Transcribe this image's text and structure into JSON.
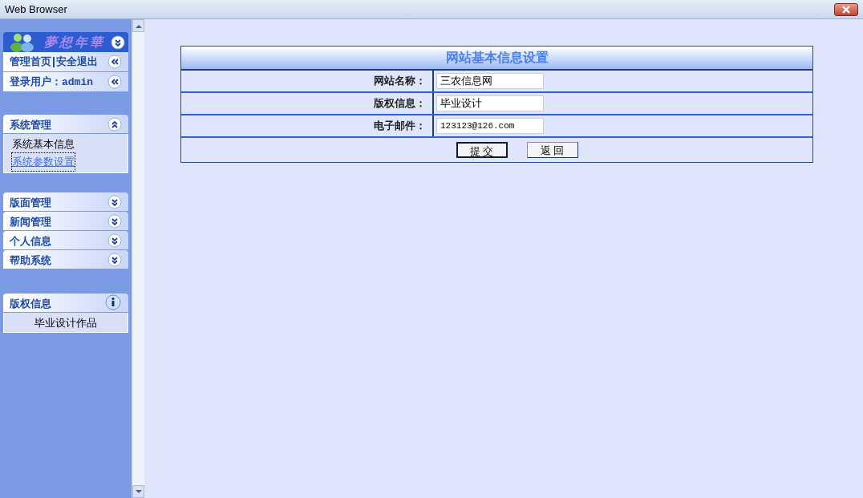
{
  "window": {
    "title": "Web Browser"
  },
  "sidebar": {
    "logo": "夢想年華",
    "top_links": [
      {
        "kind": "links",
        "parts": [
          "管理首页",
          "安全退出"
        ]
      },
      {
        "kind": "user",
        "label": "登录用户：",
        "user": "admin"
      }
    ],
    "sections": [
      {
        "title": "系统管理",
        "expanded": true,
        "items": [
          {
            "label": "系统基本信息",
            "selected": false
          },
          {
            "label": "系统参数设置",
            "selected": true
          }
        ]
      },
      {
        "title": "版面管理",
        "expanded": false
      },
      {
        "title": "新闻管理",
        "expanded": false
      },
      {
        "title": "个人信息",
        "expanded": false
      },
      {
        "title": "帮助系统",
        "expanded": false
      }
    ],
    "info": {
      "title": "版权信息",
      "text": "毕业设计作品"
    }
  },
  "form": {
    "title": "网站基本信息设置",
    "fields": [
      {
        "label": "网站名称：",
        "value": "三农信息网"
      },
      {
        "label": "版权信息：",
        "value": "毕业设计"
      },
      {
        "label": "电子邮件：",
        "value": "123123@126.com"
      }
    ],
    "buttons": [
      {
        "label": "提 交",
        "kind": "submit"
      },
      {
        "label": "返 回",
        "kind": "back"
      }
    ]
  }
}
